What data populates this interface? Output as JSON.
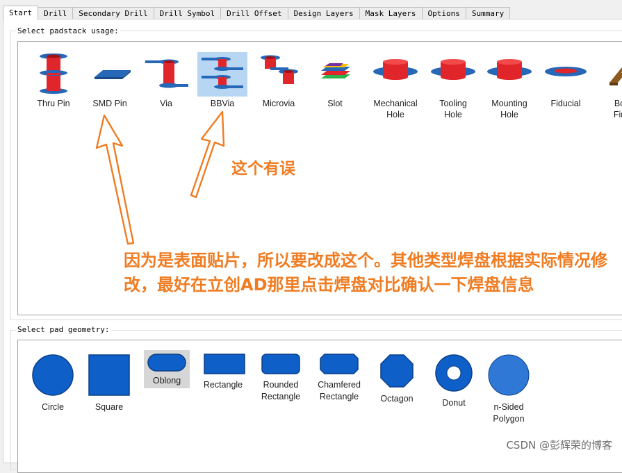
{
  "tabs": [
    "Start",
    "Drill",
    "Secondary Drill",
    "Drill Symbol",
    "Drill Offset",
    "Design Layers",
    "Mask Layers",
    "Options",
    "Summary"
  ],
  "active_tab": "Start",
  "padstack": {
    "title": "Select padstack usage:",
    "items": [
      {
        "label": "Thru Pin",
        "icon": "thru-pin-icon"
      },
      {
        "label": "SMD Pin",
        "icon": "smd-pin-icon"
      },
      {
        "label": "Via",
        "icon": "via-icon"
      },
      {
        "label": "BBVia",
        "icon": "bbvia-icon"
      },
      {
        "label": "Microvia",
        "icon": "microvia-icon"
      },
      {
        "label": "Slot",
        "icon": "slot-icon"
      },
      {
        "label": "Mechanical\nHole",
        "icon": "mechanical-hole-icon"
      },
      {
        "label": "Tooling\nHole",
        "icon": "tooling-hole-icon"
      },
      {
        "label": "Mounting\nHole",
        "icon": "mounting-hole-icon"
      },
      {
        "label": "Fiducial",
        "icon": "fiducial-icon"
      },
      {
        "label": "Bon\nFing",
        "icon": "bond-finger-icon"
      }
    ],
    "selected": "BBVia"
  },
  "geometry": {
    "title": "Select pad geometry:",
    "items": [
      {
        "label": "Circle",
        "icon": "circle-icon"
      },
      {
        "label": "Square",
        "icon": "square-icon"
      },
      {
        "label": "Oblong",
        "icon": "oblong-icon"
      },
      {
        "label": "Rectangle",
        "icon": "rectangle-icon"
      },
      {
        "label": "Rounded\nRectangle",
        "icon": "rounded-rectangle-icon"
      },
      {
        "label": "Chamfered\nRectangle",
        "icon": "chamfered-rectangle-icon"
      },
      {
        "label": "Octagon",
        "icon": "octagon-icon"
      },
      {
        "label": "Donut",
        "icon": "donut-icon"
      },
      {
        "label": "n-Sided\nPolygon",
        "icon": "n-sided-polygon-icon"
      }
    ],
    "selected": "Oblong"
  },
  "annotations": {
    "note1": "这个有误",
    "note2": "因为是表面贴片，所以要改成这个。其他类型焊盘根据实际情况修改，最好在立创AD那里点击焊盘对比确认一下焊盘信息"
  },
  "watermark": "CSDN @彭辉荣的博客",
  "colors": {
    "pad_red": "#e0262b",
    "pad_blue": "#2667b8",
    "geo_blue": "#0f5fc9",
    "annotation_orange": "#f07c22",
    "selection": "#b6d6f3"
  }
}
